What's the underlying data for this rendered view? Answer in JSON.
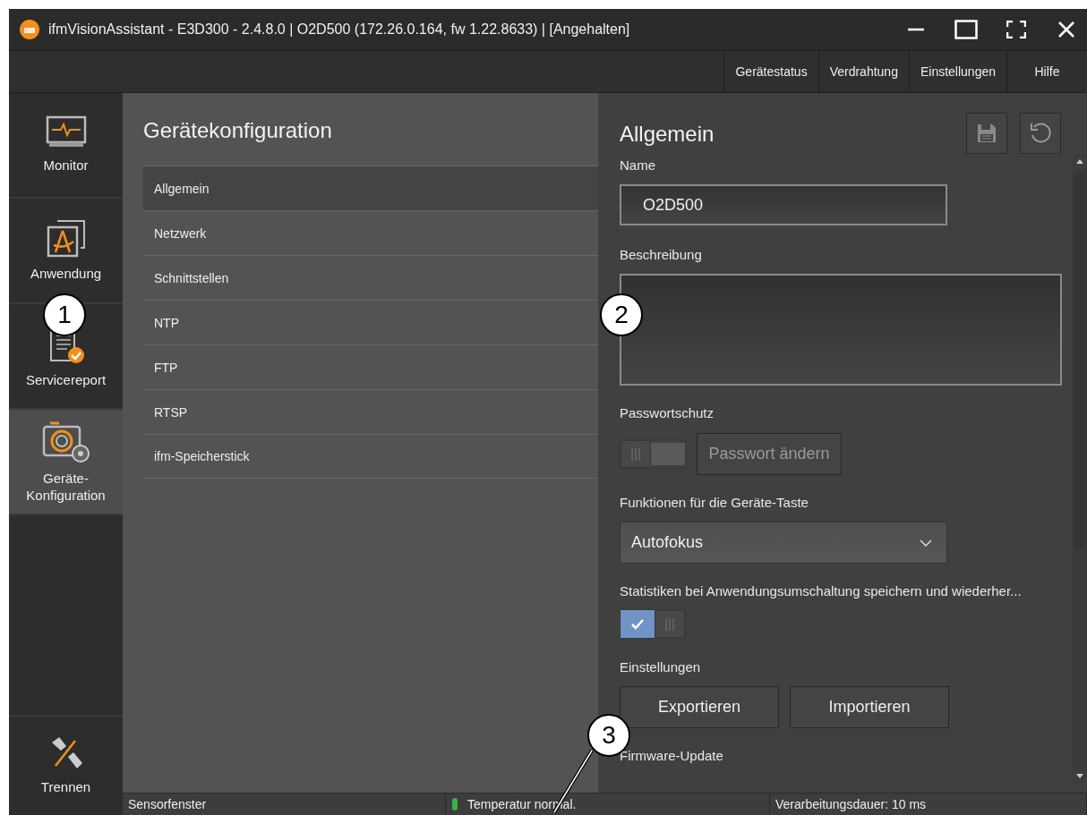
{
  "window": {
    "title": "ifmVisionAssistant - E3D300 - 2.4.8.0 | O2D500 (172.26.0.164, fw 1.22.8633) | [Angehalten]"
  },
  "menu": [
    "Gerätestatus",
    "Verdrahtung",
    "Einstellungen",
    "Hilfe"
  ],
  "sidebar": {
    "items": [
      {
        "kind": "monitor",
        "label": "Monitor",
        "selected": false
      },
      {
        "kind": "application",
        "label": "Anwendung",
        "selected": false
      },
      {
        "kind": "report",
        "label": "Servicereport",
        "selected": false
      },
      {
        "kind": "config",
        "label": "Geräte-\nKonfiguration",
        "selected": true
      }
    ],
    "bottom": {
      "kind": "disconnect",
      "label": "Trennen"
    }
  },
  "config_list": {
    "title": "Gerätekonfiguration",
    "items": [
      {
        "label": "Allgemein",
        "selected": true
      },
      {
        "label": "Netzwerk",
        "selected": false
      },
      {
        "label": "Schnittstellen",
        "selected": false
      },
      {
        "label": "NTP",
        "selected": false
      },
      {
        "label": "FTP",
        "selected": false
      },
      {
        "label": "RTSP",
        "selected": false
      },
      {
        "label": "ifm-Speicherstick",
        "selected": false
      }
    ]
  },
  "form": {
    "title": "Allgemein",
    "name_label": "Name",
    "name_value": "O2D500",
    "description_label": "Beschreibung",
    "password_label": "Passwortschutz",
    "password_protection": {
      "on": false
    },
    "password_button": {
      "label": "Passwort ändern",
      "disabled": true
    },
    "button_function_label": "Funktionen für die Geräte-Taste",
    "button_function_value": "Autofokus",
    "statistics_label": "Statistiken bei Anwendungsumschaltung speichern und wiederher...",
    "statistics": {
      "on": true
    },
    "settings_label": "Einstellungen",
    "settings_buttons": [
      "Exportieren",
      "Importieren"
    ],
    "firmware_label": "Firmware-Update"
  },
  "status_bar": {
    "left": "Sensorfenster",
    "temperature": "Temperatur normal.",
    "right": "Verarbeitungsdauer: 10 ms"
  },
  "callouts": [
    {
      "number": "1"
    },
    {
      "number": "2"
    },
    {
      "number": "3"
    }
  ]
}
